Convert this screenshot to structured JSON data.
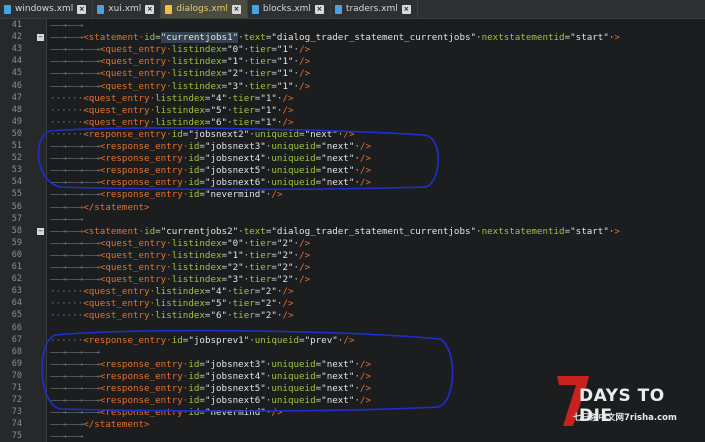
{
  "tabs": [
    {
      "label": "windows.xml",
      "active": false
    },
    {
      "label": "xui.xml",
      "active": false
    },
    {
      "label": "dialogs.xml",
      "active": true
    },
    {
      "label": "blocks.xml",
      "active": false
    },
    {
      "label": "traders.xml",
      "active": false
    }
  ],
  "colors": {
    "tag": "#e0732e",
    "attr": "#9bc441",
    "value": "#e2e2e2",
    "annotation": "#1e2fd0"
  },
  "lines": [
    {
      "n": "41",
      "ws": "——→——→",
      "code": []
    },
    {
      "n": "42",
      "ws": "——→——→",
      "fold": true,
      "code": [
        [
          "tg",
          "<statement·"
        ],
        [
          "attr",
          "id"
        ],
        [
          "eq",
          "="
        ],
        [
          "val",
          "\"currentjobs1\"",
          1
        ],
        [
          "eq",
          "·"
        ],
        [
          "attr",
          "text"
        ],
        [
          "eq",
          "="
        ],
        [
          "val",
          "\"dialog_trader_statement_currentjobs\""
        ],
        [
          "eq",
          "·"
        ],
        [
          "attr",
          "nextstatementid"
        ],
        [
          "eq",
          "="
        ],
        [
          "val",
          "\"start\""
        ],
        [
          "eq",
          "·"
        ],
        [
          "tg",
          ">"
        ]
      ]
    },
    {
      "n": "43",
      "ws": "——→——→——→",
      "code": [
        [
          "tg",
          "<quest_entry·"
        ],
        [
          "attr",
          "listindex"
        ],
        [
          "eq",
          "="
        ],
        [
          "val",
          "\"0\""
        ],
        [
          "eq",
          "·"
        ],
        [
          "attr",
          "tier"
        ],
        [
          "eq",
          "="
        ],
        [
          "val",
          "\"1\""
        ],
        [
          "eq",
          "·"
        ],
        [
          "tg",
          "/>"
        ]
      ]
    },
    {
      "n": "44",
      "ws": "——→——→——→",
      "code": [
        [
          "tg",
          "<quest_entry·"
        ],
        [
          "attr",
          "listindex"
        ],
        [
          "eq",
          "="
        ],
        [
          "val",
          "\"1\""
        ],
        [
          "eq",
          "·"
        ],
        [
          "attr",
          "tier"
        ],
        [
          "eq",
          "="
        ],
        [
          "val",
          "\"1\""
        ],
        [
          "eq",
          "·"
        ],
        [
          "tg",
          "/>"
        ]
      ]
    },
    {
      "n": "45",
      "ws": "——→——→——→",
      "code": [
        [
          "tg",
          "<quest_entry·"
        ],
        [
          "attr",
          "listindex"
        ],
        [
          "eq",
          "="
        ],
        [
          "val",
          "\"2\""
        ],
        [
          "eq",
          "·"
        ],
        [
          "attr",
          "tier"
        ],
        [
          "eq",
          "="
        ],
        [
          "val",
          "\"1\""
        ],
        [
          "eq",
          "·"
        ],
        [
          "tg",
          "/>"
        ]
      ]
    },
    {
      "n": "46",
      "ws": "——→——→——→",
      "code": [
        [
          "tg",
          "<quest_entry·"
        ],
        [
          "attr",
          "listindex"
        ],
        [
          "eq",
          "="
        ],
        [
          "val",
          "\"3\""
        ],
        [
          "eq",
          "·"
        ],
        [
          "attr",
          "tier"
        ],
        [
          "eq",
          "="
        ],
        [
          "val",
          "\"1\""
        ],
        [
          "eq",
          "·"
        ],
        [
          "tg",
          "/>"
        ]
      ]
    },
    {
      "n": "47",
      "ws": "······",
      "code": [
        [
          "tg",
          "<quest_entry·"
        ],
        [
          "attr",
          "listindex"
        ],
        [
          "eq",
          "="
        ],
        [
          "val",
          "\"4\""
        ],
        [
          "eq",
          "·"
        ],
        [
          "attr",
          "tier"
        ],
        [
          "eq",
          "="
        ],
        [
          "val",
          "\"1\""
        ],
        [
          "eq",
          "·"
        ],
        [
          "tg",
          "/>"
        ]
      ]
    },
    {
      "n": "48",
      "ws": "······",
      "code": [
        [
          "tg",
          "<quest_entry·"
        ],
        [
          "attr",
          "listindex"
        ],
        [
          "eq",
          "="
        ],
        [
          "val",
          "\"5\""
        ],
        [
          "eq",
          "·"
        ],
        [
          "attr",
          "tier"
        ],
        [
          "eq",
          "="
        ],
        [
          "val",
          "\"1\""
        ],
        [
          "eq",
          "·"
        ],
        [
          "tg",
          "/>"
        ]
      ]
    },
    {
      "n": "49",
      "ws": "······",
      "code": [
        [
          "tg",
          "<quest_entry·"
        ],
        [
          "attr",
          "listindex"
        ],
        [
          "eq",
          "="
        ],
        [
          "val",
          "\"6\""
        ],
        [
          "eq",
          "·"
        ],
        [
          "attr",
          "tier"
        ],
        [
          "eq",
          "="
        ],
        [
          "val",
          "\"1\""
        ],
        [
          "eq",
          "·"
        ],
        [
          "tg",
          "/>"
        ]
      ]
    },
    {
      "n": "50",
      "ws": "······",
      "code": [
        [
          "tg",
          "<response_entry·"
        ],
        [
          "attr",
          "id"
        ],
        [
          "eq",
          "="
        ],
        [
          "val",
          "\"jobsnext2\""
        ],
        [
          "eq",
          "·"
        ],
        [
          "attr",
          "uniqueid"
        ],
        [
          "eq",
          "="
        ],
        [
          "val",
          "\"next\""
        ],
        [
          "eq",
          "·"
        ],
        [
          "tg",
          "/>"
        ]
      ]
    },
    {
      "n": "51",
      "ws": "——→——→——→",
      "code": [
        [
          "tg",
          "<response_entry·"
        ],
        [
          "attr",
          "id"
        ],
        [
          "eq",
          "="
        ],
        [
          "val",
          "\"jobsnext3\""
        ],
        [
          "eq",
          "·"
        ],
        [
          "attr",
          "uniqueid"
        ],
        [
          "eq",
          "="
        ],
        [
          "val",
          "\"next\""
        ],
        [
          "eq",
          "·"
        ],
        [
          "tg",
          "/>"
        ]
      ]
    },
    {
      "n": "52",
      "ws": "——→——→——→",
      "code": [
        [
          "tg",
          "<response_entry·"
        ],
        [
          "attr",
          "id"
        ],
        [
          "eq",
          "="
        ],
        [
          "val",
          "\"jobsnext4\""
        ],
        [
          "eq",
          "·"
        ],
        [
          "attr",
          "uniqueid"
        ],
        [
          "eq",
          "="
        ],
        [
          "val",
          "\"next\""
        ],
        [
          "eq",
          "·"
        ],
        [
          "tg",
          "/>"
        ]
      ]
    },
    {
      "n": "53",
      "ws": "——→——→——→",
      "code": [
        [
          "tg",
          "<response_entry·"
        ],
        [
          "attr",
          "id"
        ],
        [
          "eq",
          "="
        ],
        [
          "val",
          "\"jobsnext5\""
        ],
        [
          "eq",
          "·"
        ],
        [
          "attr",
          "uniqueid"
        ],
        [
          "eq",
          "="
        ],
        [
          "val",
          "\"next\""
        ],
        [
          "eq",
          "·"
        ],
        [
          "tg",
          "/>"
        ]
      ]
    },
    {
      "n": "54",
      "ws": "——→——→——→",
      "code": [
        [
          "tg",
          "<response_entry·"
        ],
        [
          "attr",
          "id"
        ],
        [
          "eq",
          "="
        ],
        [
          "val",
          "\"jobsnext6\""
        ],
        [
          "eq",
          "·"
        ],
        [
          "attr",
          "uniqueid"
        ],
        [
          "eq",
          "="
        ],
        [
          "val",
          "\"next\""
        ],
        [
          "eq",
          "·"
        ],
        [
          "tg",
          "/>"
        ]
      ]
    },
    {
      "n": "55",
      "ws": "——→——→——→",
      "code": [
        [
          "tg",
          "<response_entry·"
        ],
        [
          "attr",
          "id"
        ],
        [
          "eq",
          "="
        ],
        [
          "val",
          "\"nevermind\""
        ],
        [
          "eq",
          "·"
        ],
        [
          "tg",
          "/>"
        ]
      ]
    },
    {
      "n": "56",
      "ws": "——→——→",
      "code": [
        [
          "tg",
          "</statement>"
        ]
      ]
    },
    {
      "n": "57",
      "ws": "——→——→",
      "code": []
    },
    {
      "n": "58",
      "ws": "——→——→",
      "fold": true,
      "code": [
        [
          "tg",
          "<statement·"
        ],
        [
          "attr",
          "id"
        ],
        [
          "eq",
          "="
        ],
        [
          "val",
          "\"currentjobs2\""
        ],
        [
          "eq",
          "·"
        ],
        [
          "attr",
          "text"
        ],
        [
          "eq",
          "="
        ],
        [
          "val",
          "\"dialog_trader_statement_currentjobs\""
        ],
        [
          "eq",
          "·"
        ],
        [
          "attr",
          "nextstatementid"
        ],
        [
          "eq",
          "="
        ],
        [
          "val",
          "\"start\""
        ],
        [
          "eq",
          "·"
        ],
        [
          "tg",
          ">"
        ]
      ]
    },
    {
      "n": "59",
      "ws": "——→——→——→",
      "code": [
        [
          "tg",
          "<quest_entry·"
        ],
        [
          "attr",
          "listindex"
        ],
        [
          "eq",
          "="
        ],
        [
          "val",
          "\"0\""
        ],
        [
          "eq",
          "·"
        ],
        [
          "attr",
          "tier"
        ],
        [
          "eq",
          "="
        ],
        [
          "val",
          "\"2\""
        ],
        [
          "eq",
          "·"
        ],
        [
          "tg",
          "/>"
        ]
      ]
    },
    {
      "n": "60",
      "ws": "——→——→——→",
      "code": [
        [
          "tg",
          "<quest_entry·"
        ],
        [
          "attr",
          "listindex"
        ],
        [
          "eq",
          "="
        ],
        [
          "val",
          "\"1\""
        ],
        [
          "eq",
          "·"
        ],
        [
          "attr",
          "tier"
        ],
        [
          "eq",
          "="
        ],
        [
          "val",
          "\"2\""
        ],
        [
          "eq",
          "·"
        ],
        [
          "tg",
          "/>"
        ]
      ]
    },
    {
      "n": "61",
      "ws": "——→——→——→",
      "code": [
        [
          "tg",
          "<quest_entry·"
        ],
        [
          "attr",
          "listindex"
        ],
        [
          "eq",
          "="
        ],
        [
          "val",
          "\"2\""
        ],
        [
          "eq",
          "·"
        ],
        [
          "attr",
          "tier"
        ],
        [
          "eq",
          "="
        ],
        [
          "val",
          "\"2\""
        ],
        [
          "eq",
          "·"
        ],
        [
          "tg",
          "/>"
        ]
      ]
    },
    {
      "n": "62",
      "ws": "——→——→——→",
      "code": [
        [
          "tg",
          "<quest_entry·"
        ],
        [
          "attr",
          "listindex"
        ],
        [
          "eq",
          "="
        ],
        [
          "val",
          "\"3\""
        ],
        [
          "eq",
          "·"
        ],
        [
          "attr",
          "tier"
        ],
        [
          "eq",
          "="
        ],
        [
          "val",
          "\"2\""
        ],
        [
          "eq",
          "·"
        ],
        [
          "tg",
          "/>"
        ]
      ]
    },
    {
      "n": "63",
      "ws": "······",
      "code": [
        [
          "tg",
          "<quest_entry·"
        ],
        [
          "attr",
          "listindex"
        ],
        [
          "eq",
          "="
        ],
        [
          "val",
          "\"4\""
        ],
        [
          "eq",
          "·"
        ],
        [
          "attr",
          "tier"
        ],
        [
          "eq",
          "="
        ],
        [
          "val",
          "\"2\""
        ],
        [
          "eq",
          "·"
        ],
        [
          "tg",
          "/>"
        ]
      ]
    },
    {
      "n": "64",
      "ws": "······",
      "code": [
        [
          "tg",
          "<quest_entry·"
        ],
        [
          "attr",
          "listindex"
        ],
        [
          "eq",
          "="
        ],
        [
          "val",
          "\"5\""
        ],
        [
          "eq",
          "·"
        ],
        [
          "attr",
          "tier"
        ],
        [
          "eq",
          "="
        ],
        [
          "val",
          "\"2\""
        ],
        [
          "eq",
          "·"
        ],
        [
          "tg",
          "/>"
        ]
      ]
    },
    {
      "n": "65",
      "ws": "······",
      "code": [
        [
          "tg",
          "<quest_entry·"
        ],
        [
          "attr",
          "listindex"
        ],
        [
          "eq",
          "="
        ],
        [
          "val",
          "\"6\""
        ],
        [
          "eq",
          "·"
        ],
        [
          "attr",
          "tier"
        ],
        [
          "eq",
          "="
        ],
        [
          "val",
          "\"2\""
        ],
        [
          "eq",
          "·"
        ],
        [
          "tg",
          "/>"
        ]
      ]
    },
    {
      "n": "66",
      "ws": "",
      "code": []
    },
    {
      "n": "67",
      "ws": "······",
      "code": [
        [
          "tg",
          "<response_entry·"
        ],
        [
          "attr",
          "id"
        ],
        [
          "eq",
          "="
        ],
        [
          "val",
          "\"jobsprev1\""
        ],
        [
          "eq",
          "·"
        ],
        [
          "attr",
          "uniqueid"
        ],
        [
          "eq",
          "="
        ],
        [
          "val",
          "\"prev\""
        ],
        [
          "eq",
          "·"
        ],
        [
          "tg",
          "/>"
        ]
      ]
    },
    {
      "n": "68",
      "ws": "——→——→——→",
      "code": []
    },
    {
      "n": "69",
      "ws": "——→——→——→",
      "code": [
        [
          "tg",
          "<response_entry·"
        ],
        [
          "attr",
          "id"
        ],
        [
          "eq",
          "="
        ],
        [
          "val",
          "\"jobsnext3\""
        ],
        [
          "eq",
          "·"
        ],
        [
          "attr",
          "uniqueid"
        ],
        [
          "eq",
          "="
        ],
        [
          "val",
          "\"next\""
        ],
        [
          "eq",
          "·"
        ],
        [
          "tg",
          "/>"
        ]
      ]
    },
    {
      "n": "70",
      "ws": "——→——→——→",
      "code": [
        [
          "tg",
          "<response_entry·"
        ],
        [
          "attr",
          "id"
        ],
        [
          "eq",
          "="
        ],
        [
          "val",
          "\"jobsnext4\""
        ],
        [
          "eq",
          "·"
        ],
        [
          "attr",
          "uniqueid"
        ],
        [
          "eq",
          "="
        ],
        [
          "val",
          "\"next\""
        ],
        [
          "eq",
          "·"
        ],
        [
          "tg",
          "/>"
        ]
      ]
    },
    {
      "n": "71",
      "ws": "——→——→——→",
      "code": [
        [
          "tg",
          "<response_entry·"
        ],
        [
          "attr",
          "id"
        ],
        [
          "eq",
          "="
        ],
        [
          "val",
          "\"jobsnext5\""
        ],
        [
          "eq",
          "·"
        ],
        [
          "attr",
          "uniqueid"
        ],
        [
          "eq",
          "="
        ],
        [
          "val",
          "\"next\""
        ],
        [
          "eq",
          "·"
        ],
        [
          "tg",
          "/>"
        ]
      ]
    },
    {
      "n": "72",
      "ws": "——→——→——→",
      "code": [
        [
          "tg",
          "<response_entry·"
        ],
        [
          "attr",
          "id"
        ],
        [
          "eq",
          "="
        ],
        [
          "val",
          "\"jobsnext6\""
        ],
        [
          "eq",
          "·"
        ],
        [
          "attr",
          "uniqueid"
        ],
        [
          "eq",
          "="
        ],
        [
          "val",
          "\"next\""
        ],
        [
          "eq",
          "·"
        ],
        [
          "tg",
          "/>"
        ]
      ]
    },
    {
      "n": "73",
      "ws": "——→——→——→",
      "code": [
        [
          "tg",
          "<response_entry·"
        ],
        [
          "attr",
          "id"
        ],
        [
          "eq",
          "="
        ],
        [
          "val",
          "\"nevermind\""
        ],
        [
          "eq",
          "·"
        ],
        [
          "tg",
          "/>"
        ]
      ]
    },
    {
      "n": "74",
      "ws": "——→——→",
      "code": [
        [
          "tg",
          "</statement>"
        ]
      ]
    },
    {
      "n": "75",
      "ws": "——→——→",
      "code": []
    }
  ],
  "watermark": {
    "title": "DAYS TO DIE",
    "mark": "7",
    "subtitle": "七日杀中文网7risha.com"
  }
}
